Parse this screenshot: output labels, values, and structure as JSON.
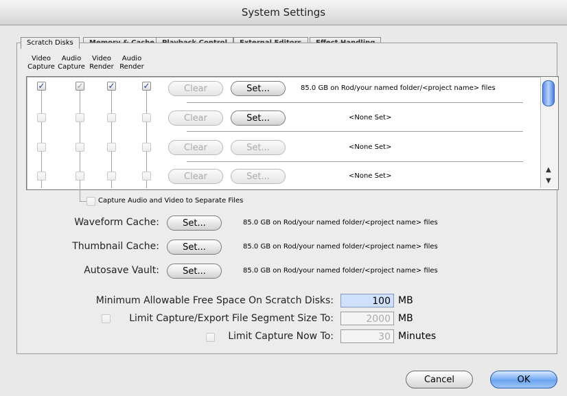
{
  "window": {
    "title": "System Settings"
  },
  "tabs": [
    {
      "label": "Scratch Disks"
    },
    {
      "label": "Memory & Cache"
    },
    {
      "label": "Playback Control"
    },
    {
      "label": "External Editors"
    },
    {
      "label": "Effect Handling"
    }
  ],
  "columns": [
    {
      "line1": "Video",
      "line2": "Capture"
    },
    {
      "line1": "Audio",
      "line2": "Capture"
    },
    {
      "line1": "Video",
      "line2": "Render"
    },
    {
      "line1": "Audio",
      "line2": "Render"
    }
  ],
  "disks": [
    {
      "clear": "Clear",
      "set": "Set...",
      "info": "85.0 GB on Rod/your named folder/<project name> files"
    },
    {
      "clear": "Clear",
      "set": "Set...",
      "info": "<None Set>"
    },
    {
      "clear": "Clear",
      "set": "Set...",
      "info": "<None Set>"
    },
    {
      "clear": "Clear",
      "set": "Set...",
      "info": "<None Set>"
    }
  ],
  "separate_files": {
    "label": "Capture Audio and Video to Separate Files"
  },
  "caches": [
    {
      "label": "Waveform Cache:",
      "button": "Set...",
      "info": "85.0 GB on Rod/your named folder/<project name> files"
    },
    {
      "label": "Thumbnail Cache:",
      "button": "Set...",
      "info": "85.0 GB on Rod/your named folder/<project name> files"
    },
    {
      "label": "Autosave Vault:",
      "button": "Set...",
      "info": "85.0 GB on Rod/your named folder/<project name> files"
    }
  ],
  "limits": {
    "min_free": {
      "label": "Minimum Allowable Free Space On Scratch Disks:",
      "value": "100",
      "unit": "MB"
    },
    "segment": {
      "label": "Limit Capture/Export File Segment Size To:",
      "value": "2000",
      "unit": "MB"
    },
    "capture_now": {
      "label": "Limit Capture Now To:",
      "value": "30",
      "unit": "Minutes"
    }
  },
  "buttons": {
    "cancel": "Cancel",
    "ok": "OK"
  },
  "scroll": {
    "up": "▲",
    "down": "▼"
  }
}
